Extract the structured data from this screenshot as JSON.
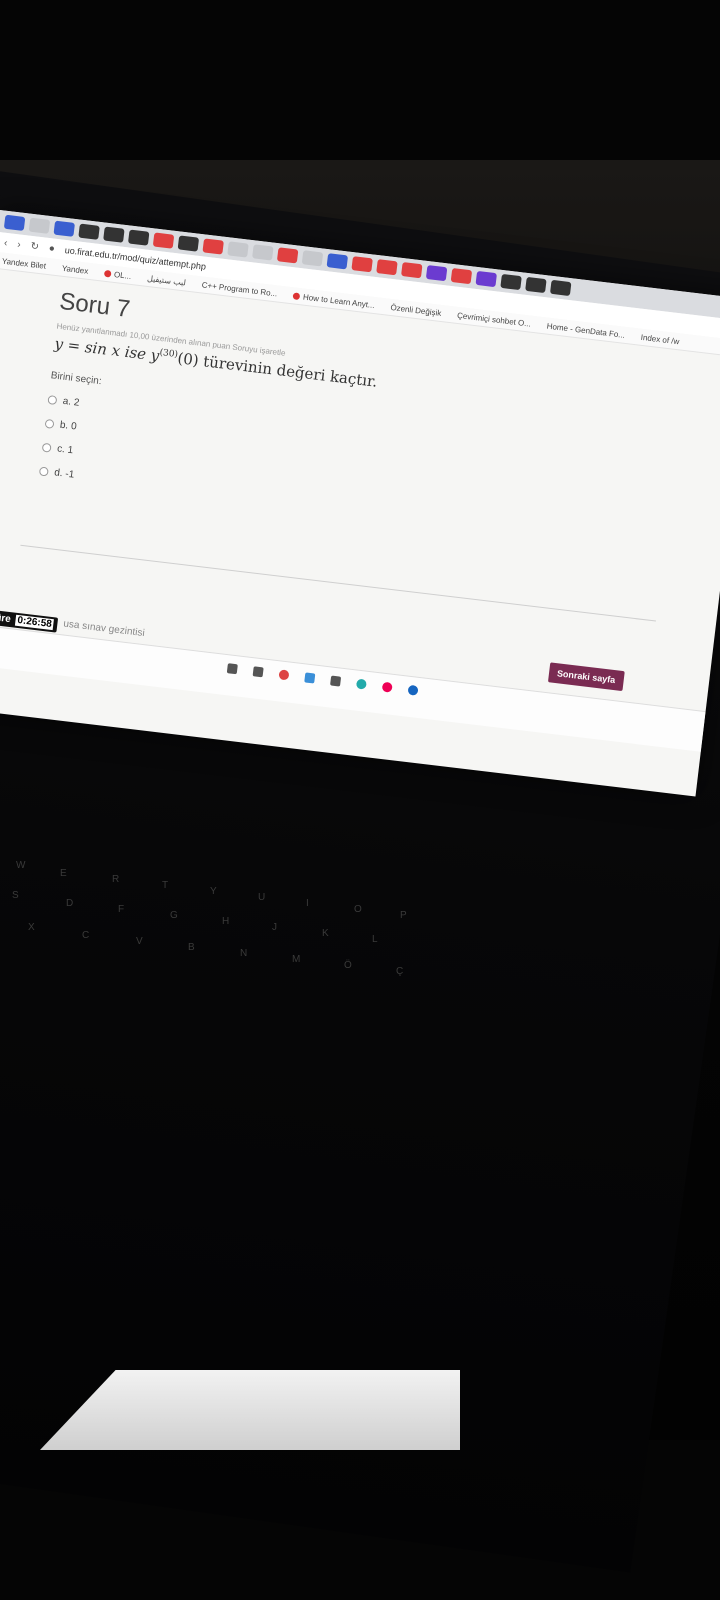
{
  "browser": {
    "tab_close": "✕",
    "url": "uo.firat.edu.tr/mod/quiz/attempt.php",
    "bookmarks": [
      "Yandex Bilet",
      "Yandex",
      "OL...",
      "ليب ستيفيل",
      "C++ Program to Ro...",
      "How to Learn Anyt...",
      "Özenli Değişik",
      "Çevrimiçi sohbet O...",
      "Home - GenData Fo...",
      "Index of /w"
    ]
  },
  "quiz": {
    "question_title": "Soru 7",
    "meta": "Henüz yanıtlanmadı   10,00 üzerinden alınan puan   Soruyu işaretle",
    "question_prefix": "y = sin x ise y",
    "question_superscript": "(30)",
    "question_suffix": "(0) türevinin değeri kaçtır.",
    "choose_label": "Birini seçin:",
    "options": [
      "a. 2",
      "b. 0",
      "c. 1",
      "d. -1"
    ],
    "timer_label": "Kalan süre",
    "timer_value": "0:26:58",
    "nav_text": "usa sınav gezintisi",
    "next_button": "Sonraki sayfa"
  },
  "keyboard": {
    "keys": [
      "W",
      "E",
      "R",
      "T",
      "Y",
      "U",
      "I",
      "O",
      "P",
      "S",
      "D",
      "F",
      "G",
      "H",
      "J",
      "K",
      "L",
      "X",
      "C",
      "V",
      "B",
      "N",
      "M",
      "Ö",
      "Ç"
    ]
  }
}
